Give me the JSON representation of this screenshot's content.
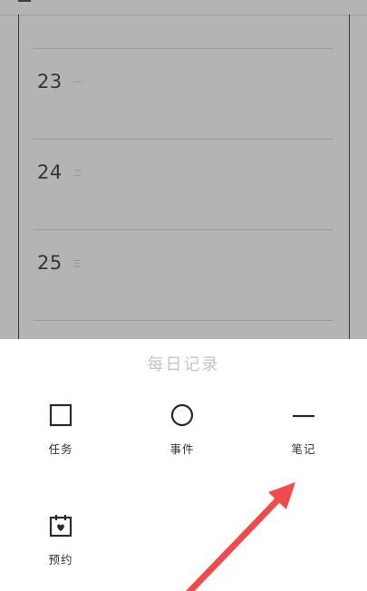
{
  "journal": {
    "days": [
      {
        "day": "23",
        "weekday": "一"
      },
      {
        "day": "24",
        "weekday": "二"
      },
      {
        "day": "25",
        "weekday": "三"
      }
    ]
  },
  "sheet": {
    "title": "每日记录",
    "options": [
      {
        "label": "任务",
        "icon": "square-icon"
      },
      {
        "label": "事件",
        "icon": "circle-icon"
      },
      {
        "label": "笔记",
        "icon": "dash-icon"
      },
      {
        "label": "预约",
        "icon": "calendar-heart-icon"
      }
    ]
  },
  "colors": {
    "annotation_arrow": "#f04a4a",
    "backdrop": "#b4b4b4"
  }
}
